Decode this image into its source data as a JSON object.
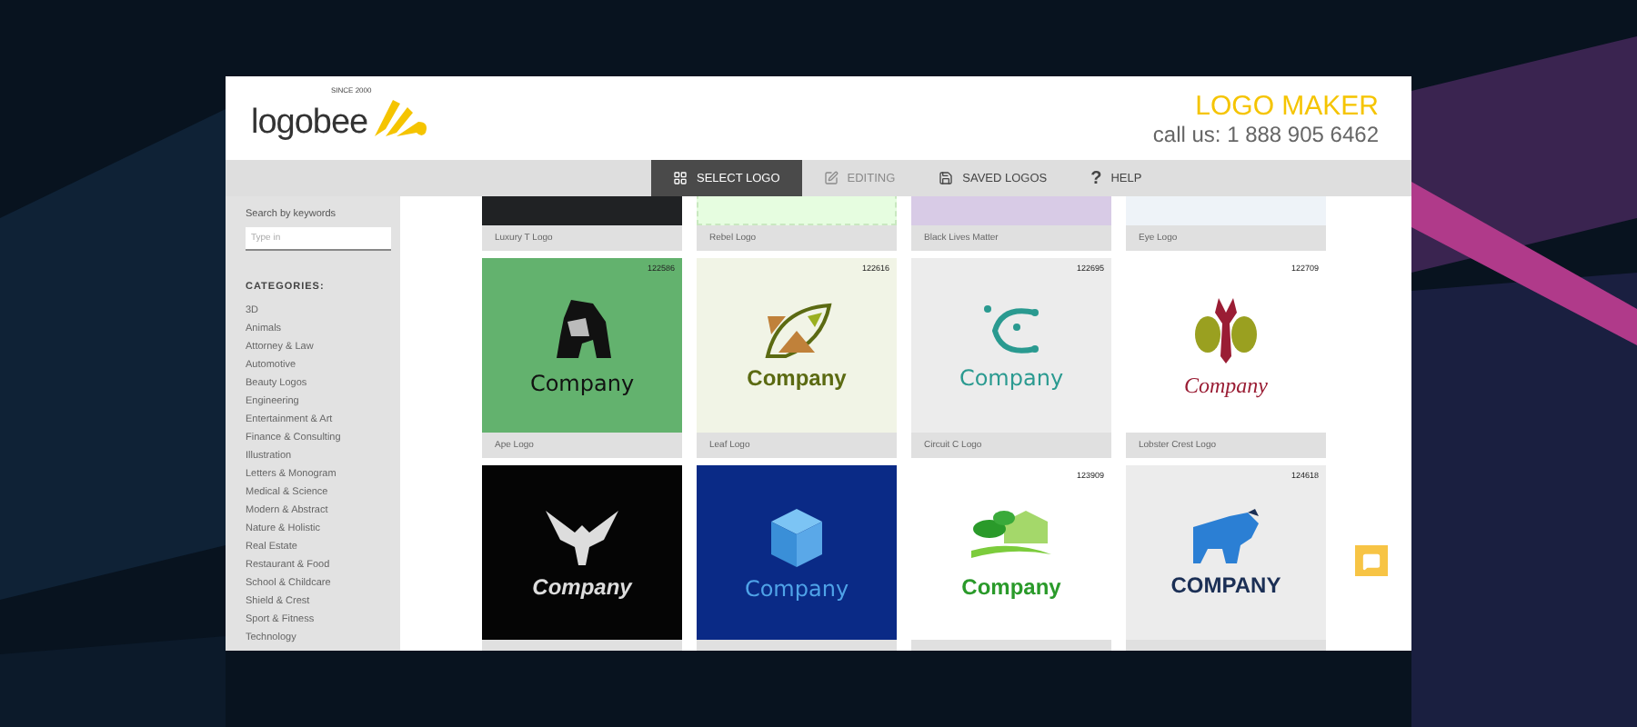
{
  "header": {
    "logo": {
      "name": "logobee",
      "tagline": "SINCE 2000"
    },
    "title": "LOGO MAKER",
    "phone": "call us: 1 888 905 6462"
  },
  "nav": [
    {
      "label": "SELECT LOGO",
      "kind": "grid",
      "selected": true,
      "disabled": false
    },
    {
      "label": "EDITING",
      "kind": "edit",
      "selected": false,
      "disabled": true
    },
    {
      "label": "SAVED LOGOS",
      "kind": "save",
      "selected": false,
      "disabled": false
    },
    {
      "label": "HELP",
      "kind": "text",
      "icon_text": "?",
      "selected": false,
      "disabled": false
    }
  ],
  "sidebar": {
    "search_label": "Search by keywords",
    "search": {
      "placeholder": "Type in"
    },
    "categories_title": "CATEGORIES:",
    "categories": [
      "3D",
      "Animals",
      "Attorney & Law",
      "Automotive",
      "Beauty Logos",
      "Engineering",
      "Entertainment & Art",
      "Finance & Consulting",
      "Illustration",
      "Letters & Monogram",
      "Medical & Science",
      "Modern & Abstract",
      "Nature & Holistic",
      "Real Estate",
      "Restaurant & Food",
      "School & Childcare",
      "Shield & Crest",
      "Sport & Fitness",
      "Technology"
    ]
  },
  "logos": [
    {
      "caption": "Luxury T Logo",
      "kind": "dark"
    },
    {
      "caption": "Rebel Logo",
      "kind": "mint"
    },
    {
      "caption": "Black Lives Matter",
      "kind": "lavender"
    },
    {
      "caption": "Eye Logo",
      "kind": "pale"
    },
    {
      "caption": "Ape Logo",
      "number": "122586",
      "kind": "gorilla",
      "brand": "Company"
    },
    {
      "caption": "Leaf Logo",
      "number": "122616",
      "kind": "leaf",
      "brand": "Company"
    },
    {
      "caption": "Circuit C Logo",
      "number": "122695",
      "kind": "circuit",
      "brand": "Company"
    },
    {
      "caption": "Lobster Crest Logo",
      "number": "122709",
      "kind": "lobster",
      "brand": "Company"
    },
    {
      "kind": "eagle",
      "brand": "Company"
    },
    {
      "kind": "cube",
      "brand": "Company"
    },
    {
      "number": "123909",
      "kind": "house",
      "brand": "Company"
    },
    {
      "number": "124618",
      "kind": "bull",
      "brand": "COMPANY"
    }
  ]
}
